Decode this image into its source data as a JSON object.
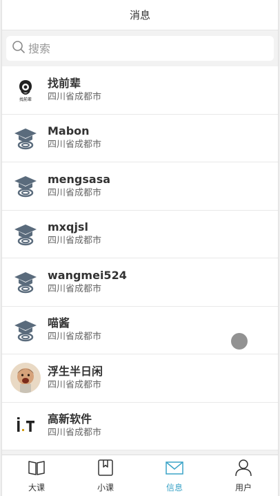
{
  "header": {
    "title": "消息"
  },
  "search": {
    "placeholder": "搜索",
    "value": ""
  },
  "messages": [
    {
      "name": "找前辈",
      "subtitle": "四川省成都市",
      "avatar": "logo-avatar"
    },
    {
      "name": "Mabon",
      "subtitle": "四川省成都市",
      "avatar": "graduate-cap-avatar"
    },
    {
      "name": "mengsasa",
      "subtitle": "四川省成都市",
      "avatar": "graduate-cap-avatar"
    },
    {
      "name": "mxqjsl",
      "subtitle": "四川省成都市",
      "avatar": "graduate-cap-avatar"
    },
    {
      "name": "wangmei524",
      "subtitle": "四川省成都市",
      "avatar": "graduate-cap-avatar"
    },
    {
      "name": "喵酱",
      "subtitle": "四川省成都市",
      "avatar": "graduate-cap-avatar"
    },
    {
      "name": "浮生半日闲",
      "subtitle": "四川省成都市",
      "avatar": "photo-avatar"
    },
    {
      "name": "高新软件",
      "subtitle": "四川省成都市",
      "avatar": "it-logo-avatar"
    }
  ],
  "tabs": [
    {
      "label": "大课",
      "icon": "book-icon",
      "active": false
    },
    {
      "label": "小课",
      "icon": "bookmark-icon",
      "active": false
    },
    {
      "label": "信息",
      "icon": "mail-icon",
      "active": true
    },
    {
      "label": "用户",
      "icon": "user-icon",
      "active": false
    }
  ],
  "colors": {
    "active_tab": "#3aa3c7",
    "text": "#333333",
    "subtext": "#666666"
  }
}
